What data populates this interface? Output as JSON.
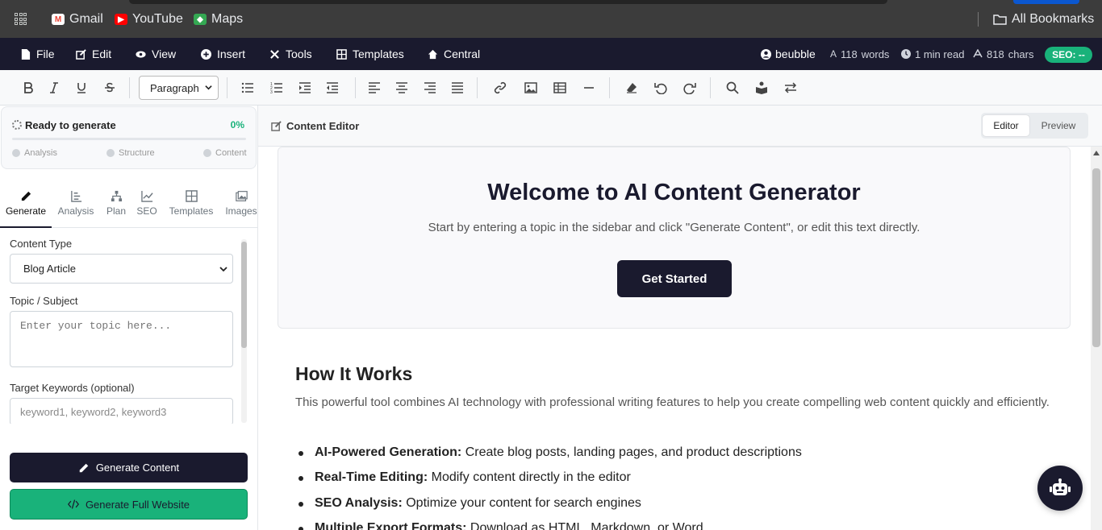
{
  "bookmarks": {
    "items": [
      {
        "label": "Gmail",
        "icon": "gmail-icon"
      },
      {
        "label": "YouTube",
        "icon": "youtube-icon"
      },
      {
        "label": "Maps",
        "icon": "maps-icon"
      }
    ],
    "all_bookmarks": "All Bookmarks"
  },
  "menubar": {
    "items": [
      {
        "label": "File",
        "icon": "file-icon"
      },
      {
        "label": "Edit",
        "icon": "edit-icon"
      },
      {
        "label": "View",
        "icon": "eye-icon"
      },
      {
        "label": "Insert",
        "icon": "plus-circle-icon"
      },
      {
        "label": "Tools",
        "icon": "tools-icon"
      },
      {
        "label": "Templates",
        "icon": "table-icon"
      },
      {
        "label": "Central",
        "icon": "home-icon"
      }
    ],
    "user": "beubble",
    "words": "118",
    "words_unit": "words",
    "read_time": "1 min read",
    "chars": "818",
    "chars_unit": "chars",
    "seo_badge": "SEO: --"
  },
  "toolbar": {
    "block_format": "Paragraph"
  },
  "progress": {
    "title": "Ready to generate",
    "percent_label": "0%",
    "percent_value": 0,
    "steps": [
      "Analysis",
      "Structure",
      "Content"
    ]
  },
  "tabs": [
    "Generate",
    "Analysis",
    "Plan",
    "SEO",
    "Templates",
    "Images"
  ],
  "form": {
    "content_type_label": "Content Type",
    "content_type_value": "Blog Article",
    "topic_label": "Topic / Subject",
    "topic_placeholder": "Enter your topic here...",
    "keywords_label": "Target Keywords (optional)",
    "keywords_placeholder": "keyword1, keyword2, keyword3"
  },
  "actions": {
    "generate": "Generate Content",
    "generate_site": "Generate Full Website"
  },
  "main": {
    "header_title": "Content Editor",
    "view_editor": "Editor",
    "view_preview": "Preview",
    "hero_title": "Welcome to AI Content Generator",
    "hero_text": "Start by entering a topic in the sidebar and click \"Generate Content\", or edit this text directly.",
    "hero_button": "Get Started",
    "how_title": "How It Works",
    "how_intro": "This powerful tool combines AI technology with professional writing features to help you create compelling web content quickly and efficiently.",
    "features": [
      {
        "bold": "AI-Powered Generation:",
        "text": " Create blog posts, landing pages, and product descriptions"
      },
      {
        "bold": "Real-Time Editing:",
        "text": " Modify content directly in the editor"
      },
      {
        "bold": "SEO Analysis:",
        "text": " Optimize your content for search engines"
      },
      {
        "bold": "Multiple Export Formats:",
        "text": " Download as HTML, Markdown, or Word"
      }
    ]
  },
  "colors": {
    "navy": "#1a1a2e",
    "green": "#19b27a"
  }
}
